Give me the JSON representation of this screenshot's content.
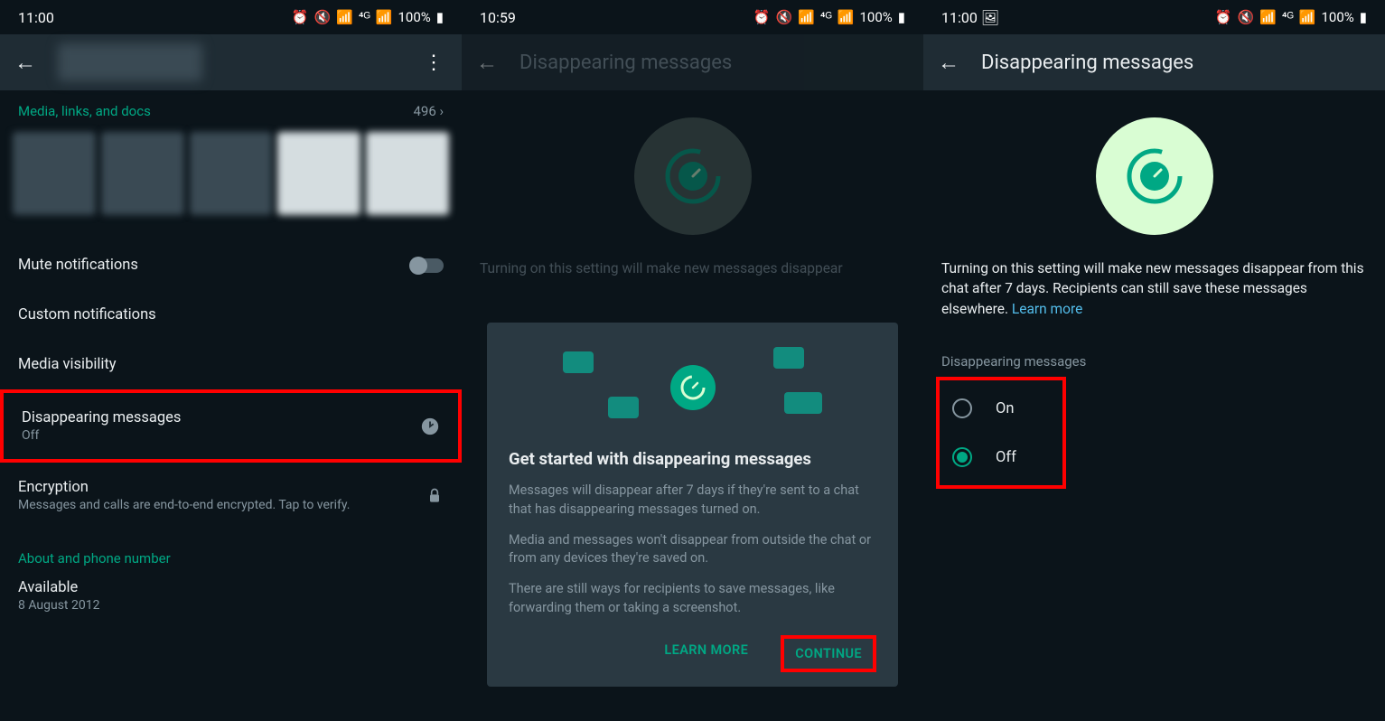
{
  "p1": {
    "time": "11:00",
    "battery": "100%",
    "media_label": "Media, links, and docs",
    "media_count": "496",
    "mute": "Mute notifications",
    "custom": "Custom notifications",
    "visibility": "Media visibility",
    "disappear": {
      "label": "Disappearing messages",
      "value": "Off"
    },
    "encryption": {
      "label": "Encryption",
      "sub": "Messages and calls are end-to-end encrypted. Tap to verify."
    },
    "about_heading": "About and phone number",
    "status": "Available",
    "date": "8 August 2012"
  },
  "p2": {
    "time": "10:59",
    "battery": "100%",
    "title": "Disappearing messages",
    "desc": "Turning on this setting will make new messages disappear",
    "modal_title": "Get started with disappearing messages",
    "modal_p1": "Messages will disappear after 7 days if they're sent to a chat that has disappearing messages turned on.",
    "modal_p2": "Media and messages won't disappear from outside the chat or from any devices they're saved on.",
    "modal_p3": "There are still ways for recipients to save messages, like forwarding them or taking a screenshot.",
    "learn_more": "LEARN MORE",
    "continue": "CONTINUE"
  },
  "p3": {
    "time": "11:00",
    "battery": "100%",
    "title": "Disappearing messages",
    "desc": "Turning on this setting will make new messages disappear from this chat after 7 days. Recipients can still save these messages elsewhere. ",
    "learn_more": "Learn more",
    "section": "Disappearing messages",
    "on": "On",
    "off": "Off"
  }
}
